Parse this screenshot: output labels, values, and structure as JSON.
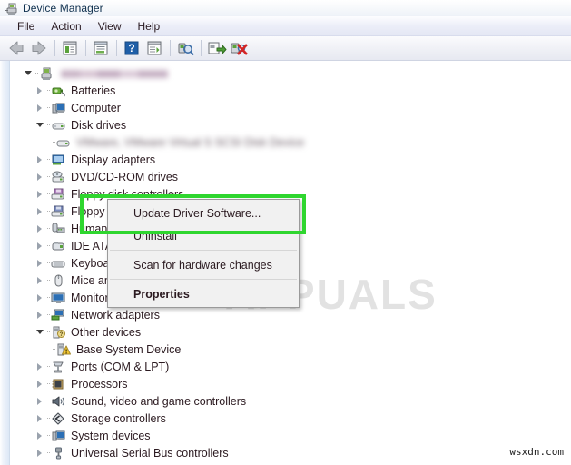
{
  "window": {
    "title": "Device Manager",
    "title_icon": "device-manager-icon"
  },
  "menubar": {
    "items": [
      {
        "label": "File"
      },
      {
        "label": "Action"
      },
      {
        "label": "View"
      },
      {
        "label": "Help"
      }
    ]
  },
  "toolbar": {
    "buttons": [
      {
        "name": "back-arrow-icon",
        "tooltip": "Back"
      },
      {
        "name": "forward-arrow-icon",
        "tooltip": "Forward"
      },
      {
        "name": "show-hide-console-tree-icon",
        "tooltip": "Show/Hide Console Tree"
      },
      {
        "name": "properties-icon",
        "tooltip": "Properties"
      },
      {
        "name": "help-icon",
        "tooltip": "Help"
      },
      {
        "name": "show-hide-action-pane-icon",
        "tooltip": "Show/Hide Action Pane"
      },
      {
        "name": "scan-for-hardware-changes-icon",
        "tooltip": "Scan for hardware changes"
      },
      {
        "name": "update-driver-icon",
        "tooltip": "Update Driver Software"
      },
      {
        "name": "uninstall-device-icon",
        "tooltip": "Uninstall"
      }
    ]
  },
  "tree": {
    "root": {
      "label": "",
      "redacted": true,
      "icon": "computer-root-icon",
      "expanded": true
    },
    "items": [
      {
        "label": "Batteries",
        "icon": "battery-icon",
        "state": "collapsed",
        "level": 1
      },
      {
        "label": "Computer",
        "icon": "computer-icon",
        "state": "collapsed",
        "level": 1
      },
      {
        "label": "Disk drives",
        "icon": "disk-drive-icon",
        "state": "expanded",
        "level": 1
      },
      {
        "label": "VMware, VMware Virtual S SCSI Disk Device",
        "icon": "disk-icon",
        "state": "leaf",
        "level": 2,
        "redacted": true,
        "selected": true
      },
      {
        "label": "Display adapters",
        "icon": "display-adapter-icon",
        "state": "collapsed",
        "level": 1
      },
      {
        "label": "DVD/CD-ROM drives",
        "icon": "dvd-drive-icon",
        "state": "collapsed",
        "level": 1
      },
      {
        "label": "Floppy disk controllers",
        "icon": "floppy-controller-icon",
        "state": "collapsed",
        "level": 1
      },
      {
        "label": "Floppy disk drives",
        "icon": "floppy-drive-icon",
        "state": "collapsed",
        "level": 1
      },
      {
        "label": "Human Interface Devices",
        "icon": "hid-icon",
        "state": "collapsed",
        "level": 1
      },
      {
        "label": "IDE ATA/ATAPI controllers",
        "icon": "ide-controller-icon",
        "state": "collapsed",
        "level": 1
      },
      {
        "label": "Keyboards",
        "icon": "keyboard-icon",
        "state": "collapsed",
        "level": 1
      },
      {
        "label": "Mice and other pointing devices",
        "icon": "mouse-icon",
        "state": "collapsed",
        "level": 1
      },
      {
        "label": "Monitors",
        "icon": "monitor-icon",
        "state": "collapsed",
        "level": 1
      },
      {
        "label": "Network adapters",
        "icon": "network-adapter-icon",
        "state": "collapsed",
        "level": 1
      },
      {
        "label": "Other devices",
        "icon": "other-devices-icon",
        "state": "expanded",
        "level": 1
      },
      {
        "label": "Base System Device",
        "icon": "warning-device-icon",
        "state": "leaf",
        "level": 2
      },
      {
        "label": "Ports (COM & LPT)",
        "icon": "port-icon",
        "state": "collapsed",
        "level": 1
      },
      {
        "label": "Processors",
        "icon": "processor-icon",
        "state": "collapsed",
        "level": 1
      },
      {
        "label": "Sound, video and game controllers",
        "icon": "sound-icon",
        "state": "collapsed",
        "level": 1
      },
      {
        "label": "Storage controllers",
        "icon": "storage-controller-icon",
        "state": "collapsed",
        "level": 1
      },
      {
        "label": "System devices",
        "icon": "system-device-icon",
        "state": "collapsed",
        "level": 1
      },
      {
        "label": "Universal Serial Bus controllers",
        "icon": "usb-icon",
        "state": "collapsed",
        "level": 1
      }
    ]
  },
  "context_menu": {
    "items": [
      {
        "label": "Update Driver Software...",
        "bold": false,
        "separator_after": false
      },
      {
        "label": "Uninstall",
        "bold": false,
        "separator_after": true
      },
      {
        "label": "Scan for hardware changes",
        "bold": false,
        "separator_after": true
      },
      {
        "label": "Properties",
        "bold": true,
        "separator_after": false
      }
    ]
  },
  "annotation": {
    "highlight_color": "#2fd62f",
    "highlight_label": "update-driver-software-highlight"
  },
  "watermark": {
    "text": "APPUALS",
    "color": "#e2e2e2"
  },
  "footer": {
    "site": "wsxdn.com"
  }
}
